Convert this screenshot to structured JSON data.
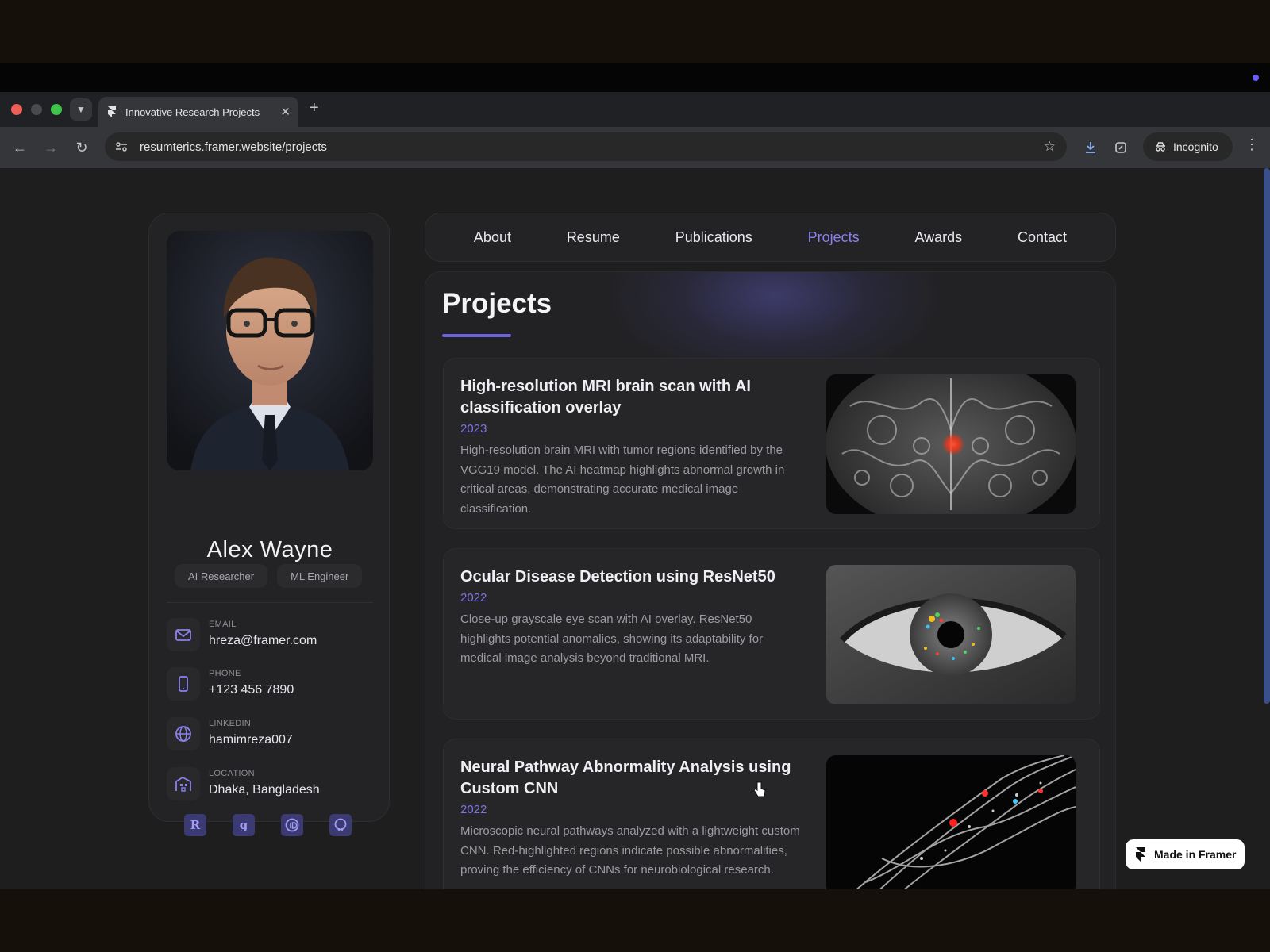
{
  "browser": {
    "tab_title": "Innovative Research Projects",
    "url": "resumterics.framer.website/projects",
    "incognito_label": "Incognito"
  },
  "profile": {
    "name": "Alex Wayne",
    "roles": [
      "AI Researcher",
      "ML Engineer"
    ],
    "contacts": [
      {
        "label": "EMAIL",
        "value": "hreza@framer.com",
        "icon": "mail-icon"
      },
      {
        "label": "PHONE",
        "value": "+123 456 7890",
        "icon": "phone-icon"
      },
      {
        "label": "LINKEDIN",
        "value": "hamimreza007",
        "icon": "globe-icon"
      },
      {
        "label": "LOCATION",
        "value": "Dhaka, Bangladesh",
        "icon": "building-icon"
      }
    ],
    "socials": [
      "researchgate-icon",
      "google-scholar-icon",
      "orcid-icon",
      "github-icon"
    ]
  },
  "nav": {
    "items": [
      "About",
      "Resume",
      "Publications",
      "Projects",
      "Awards",
      "Contact"
    ],
    "active": "Projects"
  },
  "page": {
    "title": "Projects"
  },
  "projects": [
    {
      "title": "High-resolution MRI brain scan with AI classification overlay",
      "year": "2023",
      "description": "High-resolution brain MRI with tumor regions identified by the VGG19 model. The AI heatmap highlights abnormal growth in critical areas, demonstrating accurate medical image classification."
    },
    {
      "title": "Ocular Disease Detection using ResNet50",
      "year": "2022",
      "description": "Close-up grayscale eye scan with AI overlay. ResNet50 highlights potential anomalies, showing its adaptability for medical image analysis beyond traditional MRI."
    },
    {
      "title": "Neural Pathway Abnormality Analysis using Custom CNN",
      "year": "2022",
      "description": "Microscopic neural pathways analyzed with a lightweight custom CNN. Red-highlighted regions indicate possible abnormalities, proving the efficiency of CNNs for neurobiological research."
    }
  ],
  "badge": {
    "label": "Made in Framer"
  },
  "colors": {
    "accent": "#8a80f0",
    "background": "#1e1e1f",
    "card": "#232325"
  }
}
